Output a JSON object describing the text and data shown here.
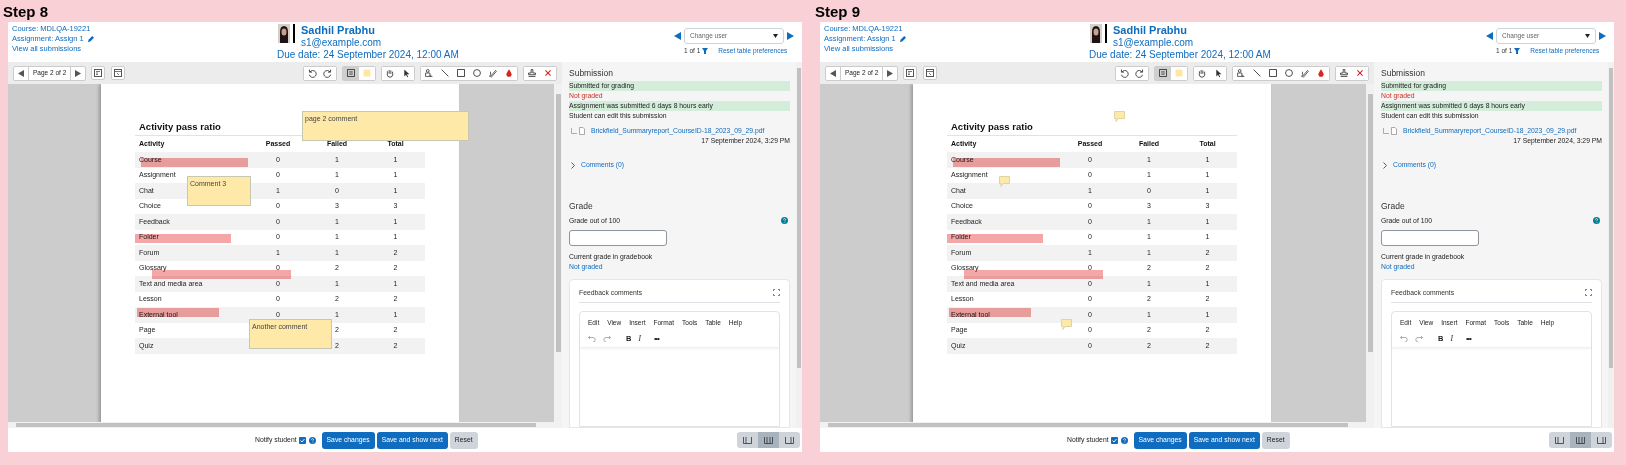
{
  "panels": [
    {
      "step_label": "Step 8",
      "header": {
        "course_link": "Course: MDLQA-19221",
        "assignment_link": "Assignment: Assign 1",
        "view_all_link": "View all submissions",
        "user_name": "Sadhil Prabhu",
        "user_email": "s1@example.com",
        "due_date": "Due date: 24 September 2024, 12:00 AM",
        "change_user": {
          "placeholder": "Change user"
        },
        "pager": "1 of 1",
        "reset_link": "Reset table preferences"
      },
      "toolbar": {
        "page_label": "Page 2 of 2",
        "tool_groups": [
          [
            {
              "kind": "rotate-left",
              "selected": false
            },
            {
              "kind": "rotate-right",
              "selected": false
            }
          ],
          [
            {
              "kind": "comment",
              "selected": true
            },
            {
              "kind": "comment-color",
              "selected": false
            }
          ],
          [
            {
              "kind": "pan",
              "selected": false
            },
            {
              "kind": "select",
              "selected": false
            }
          ],
          [
            {
              "kind": "highlight",
              "selected": false
            },
            {
              "kind": "line",
              "selected": false
            },
            {
              "kind": "rectangle",
              "selected": false
            },
            {
              "kind": "oval",
              "selected": false
            },
            {
              "kind": "pen",
              "selected": false
            },
            {
              "kind": "color",
              "selected": false
            }
          ],
          [
            {
              "kind": "stamp",
              "selected": false
            },
            {
              "kind": "delete",
              "selected": false
            }
          ]
        ]
      },
      "document": {
        "title": "Activity pass ratio",
        "columns": [
          "Activity",
          "Passed",
          "Failed",
          "Total"
        ],
        "rows": [
          {
            "cells": [
              "Course",
              "0",
              "1",
              "1"
            ],
            "highlighted": true
          },
          {
            "cells": [
              "Assignment",
              "0",
              "1",
              "1"
            ],
            "highlighted": false
          },
          {
            "cells": [
              "Chat",
              "1",
              "0",
              "1"
            ],
            "highlighted": false
          },
          {
            "cells": [
              "Choice",
              "0",
              "3",
              "3"
            ],
            "highlighted": false
          },
          {
            "cells": [
              "Feedback",
              "0",
              "1",
              "1"
            ],
            "highlighted": false
          },
          {
            "cells": [
              "Folder",
              "0",
              "1",
              "1"
            ],
            "highlighted": true
          },
          {
            "cells": [
              "Forum",
              "1",
              "1",
              "2"
            ],
            "highlighted": false
          },
          {
            "cells": [
              "Glossary",
              "0",
              "2",
              "2"
            ],
            "highlighted": true
          },
          {
            "cells": [
              "Text and media area",
              "0",
              "1",
              "1"
            ],
            "highlighted": false
          },
          {
            "cells": [
              "Lesson",
              "0",
              "2",
              "2"
            ],
            "highlighted": false
          },
          {
            "cells": [
              "External tool",
              "0",
              "1",
              "1"
            ],
            "highlighted": true
          },
          {
            "cells": [
              "Page",
              null,
              "2",
              "2"
            ],
            "highlighted": false
          },
          {
            "cells": [
              "Quiz",
              null,
              "2",
              "2"
            ],
            "highlighted": false
          }
        ],
        "comments": [
          {
            "text": "page 2 comment",
            "expanded": true
          },
          {
            "text": "Comment 3",
            "expanded": true
          },
          {
            "text": "Another comment",
            "expanded": true
          }
        ]
      },
      "sidebar": {
        "section_title": "Submission",
        "statuses": [
          {
            "text": "Submitted for grading",
            "kind": "success"
          },
          {
            "text": "Not graded",
            "kind": "danger"
          },
          {
            "text": "Assignment was submitted 6 days 8 hours early",
            "kind": "success"
          },
          {
            "text": "Student can edit this submission",
            "kind": "plain"
          }
        ],
        "file": {
          "name": "Brickfield_Summaryreport_CourseID-18_2023_09_29.pdf",
          "date": "17 September 2024, 3:29 PM"
        },
        "comments_link": "Comments (0)",
        "grade": {
          "heading": "Grade",
          "label": "Grade out of 100",
          "current_label": "Current grade in gradebook",
          "current_value": "Not graded"
        },
        "feedback": {
          "title": "Feedback comments",
          "menu": [
            "Edit",
            "View",
            "Insert",
            "Format",
            "Tools",
            "Table",
            "Help"
          ],
          "format_buttons": [
            "B",
            "I",
            "•••"
          ]
        }
      },
      "footer": {
        "notify": {
          "label": "Notify student",
          "checked": true
        },
        "buttons": [
          {
            "label": "Save changes",
            "kind": "primary"
          },
          {
            "label": "Save and show next",
            "kind": "primary"
          },
          {
            "label": "Reset",
            "kind": "secondary"
          }
        ],
        "layouts": [
          {
            "selected": false
          },
          {
            "selected": true
          },
          {
            "selected": false
          }
        ]
      }
    },
    {
      "step_label": "Step 9",
      "header": {
        "course_link": "Course: MDLQA-19221",
        "assignment_link": "Assignment: Assign 1",
        "view_all_link": "View all submissions",
        "user_name": "Sadhil Prabhu",
        "user_email": "s1@example.com",
        "due_date": "Due date: 24 September 2024, 12:00 AM",
        "change_user": {
          "placeholder": "Change user"
        },
        "pager": "1 of 1",
        "reset_link": "Reset table preferences"
      },
      "toolbar": {
        "page_label": "Page 2 of 2",
        "tool_groups": [
          [
            {
              "kind": "rotate-left",
              "selected": false
            },
            {
              "kind": "rotate-right",
              "selected": false
            }
          ],
          [
            {
              "kind": "comment",
              "selected": true
            },
            {
              "kind": "comment-color",
              "selected": false
            }
          ],
          [
            {
              "kind": "pan",
              "selected": false
            },
            {
              "kind": "select",
              "selected": false
            }
          ],
          [
            {
              "kind": "highlight",
              "selected": false
            },
            {
              "kind": "line",
              "selected": false
            },
            {
              "kind": "rectangle",
              "selected": false
            },
            {
              "kind": "oval",
              "selected": false
            },
            {
              "kind": "pen",
              "selected": false
            },
            {
              "kind": "color",
              "selected": false
            }
          ],
          [
            {
              "kind": "stamp",
              "selected": false
            },
            {
              "kind": "delete",
              "selected": false
            }
          ]
        ]
      },
      "document": {
        "title": "Activity pass ratio",
        "columns": [
          "Activity",
          "Passed",
          "Failed",
          "Total"
        ],
        "rows": [
          {
            "cells": [
              "Course",
              "0",
              "1",
              "1"
            ],
            "highlighted": true
          },
          {
            "cells": [
              "Assignment",
              "0",
              "1",
              "1"
            ],
            "highlighted": false
          },
          {
            "cells": [
              "Chat",
              "1",
              "0",
              "1"
            ],
            "highlighted": false
          },
          {
            "cells": [
              "Choice",
              "0",
              "3",
              "3"
            ],
            "highlighted": false
          },
          {
            "cells": [
              "Feedback",
              "0",
              "1",
              "1"
            ],
            "highlighted": false
          },
          {
            "cells": [
              "Folder",
              "0",
              "1",
              "1"
            ],
            "highlighted": true
          },
          {
            "cells": [
              "Forum",
              "1",
              "1",
              "2"
            ],
            "highlighted": false
          },
          {
            "cells": [
              "Glossary",
              "0",
              "2",
              "2"
            ],
            "highlighted": true
          },
          {
            "cells": [
              "Text and media area",
              "0",
              "1",
              "1"
            ],
            "highlighted": false
          },
          {
            "cells": [
              "Lesson",
              "0",
              "2",
              "2"
            ],
            "highlighted": false
          },
          {
            "cells": [
              "External tool",
              "0",
              "1",
              "1"
            ],
            "highlighted": true
          },
          {
            "cells": [
              "Page",
              "0",
              "2",
              "2"
            ],
            "highlighted": false
          },
          {
            "cells": [
              "Quiz",
              "0",
              "2",
              "2"
            ],
            "highlighted": false
          }
        ],
        "comments": [
          {
            "expanded": false
          },
          {
            "expanded": false
          },
          {
            "expanded": false
          }
        ]
      },
      "sidebar": {
        "section_title": "Submission",
        "statuses": [
          {
            "text": "Submitted for grading",
            "kind": "success"
          },
          {
            "text": "Not graded",
            "kind": "danger"
          },
          {
            "text": "Assignment was submitted 6 days 8 hours early",
            "kind": "success"
          },
          {
            "text": "Student can edit this submission",
            "kind": "plain"
          }
        ],
        "file": {
          "name": "Brickfield_Summaryreport_CourseID-18_2023_09_29.pdf",
          "date": "17 September 2024, 3:29 PM"
        },
        "comments_link": "Comments (0)",
        "grade": {
          "heading": "Grade",
          "label": "Grade out of 100",
          "current_label": "Current grade in gradebook",
          "current_value": "Not graded"
        },
        "feedback": {
          "title": "Feedback comments",
          "menu": [
            "Edit",
            "View",
            "Insert",
            "Format",
            "Tools",
            "Table",
            "Help"
          ],
          "format_buttons": [
            "B",
            "I",
            "•••"
          ]
        }
      },
      "footer": {
        "notify": {
          "label": "Notify student",
          "checked": true
        },
        "buttons": [
          {
            "label": "Save changes",
            "kind": "primary"
          },
          {
            "label": "Save and show next",
            "kind": "primary"
          },
          {
            "label": "Reset",
            "kind": "secondary"
          }
        ],
        "layouts": [
          {
            "selected": false
          },
          {
            "selected": true
          },
          {
            "selected": false
          }
        ]
      }
    }
  ]
}
